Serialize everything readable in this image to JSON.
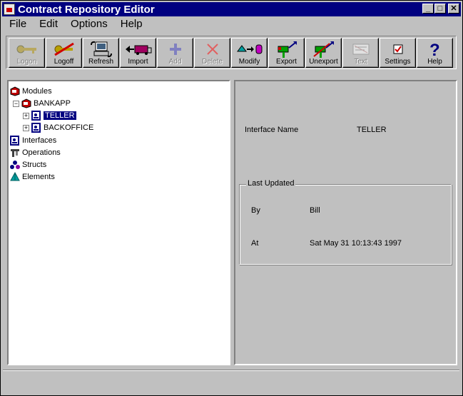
{
  "window": {
    "title": "Contract Repository Editor"
  },
  "menu": [
    "File",
    "Edit",
    "Options",
    "Help"
  ],
  "toolbar": [
    {
      "label": "Logon",
      "icon": "key-icon",
      "enabled": false
    },
    {
      "label": "Logoff",
      "icon": "key-crossed-icon",
      "enabled": true
    },
    {
      "label": "Refresh",
      "icon": "refresh-computer-icon",
      "enabled": true
    },
    {
      "label": "Import",
      "icon": "import-truck-icon",
      "enabled": true
    },
    {
      "label": "Add",
      "icon": "plus-icon",
      "enabled": false
    },
    {
      "label": "Delete",
      "icon": "x-delete-icon",
      "enabled": false
    },
    {
      "label": "Modify",
      "icon": "modify-shapes-icon",
      "enabled": true
    },
    {
      "label": "Export",
      "icon": "export-mailbox-icon",
      "enabled": true
    },
    {
      "label": "Unexport",
      "icon": "unexport-mailbox-icon",
      "enabled": true
    },
    {
      "label": "Text",
      "icon": "text-icon",
      "enabled": false
    },
    {
      "label": "Settings",
      "icon": "settings-check-icon",
      "enabled": true
    },
    {
      "label": "Help",
      "icon": "question-icon",
      "enabled": true
    }
  ],
  "tree": {
    "modules": "Modules",
    "bankapp": "BANKAPP",
    "teller": "TELLER",
    "backoffice": "BACKOFFICE",
    "interfaces": "Interfaces",
    "operations": "Operations",
    "structs": "Structs",
    "elements": "Elements"
  },
  "details": {
    "interface_name_label": "Interface Name",
    "interface_name_value": "TELLER",
    "last_updated_legend": "Last Updated",
    "by_label": "By",
    "by_value": "Bill",
    "at_label": "At",
    "at_value": "Sat May 31 10:13:43 1997"
  },
  "colors": {
    "titlebar": "#000080",
    "face": "#c0c0c0",
    "selection": "#000080"
  }
}
